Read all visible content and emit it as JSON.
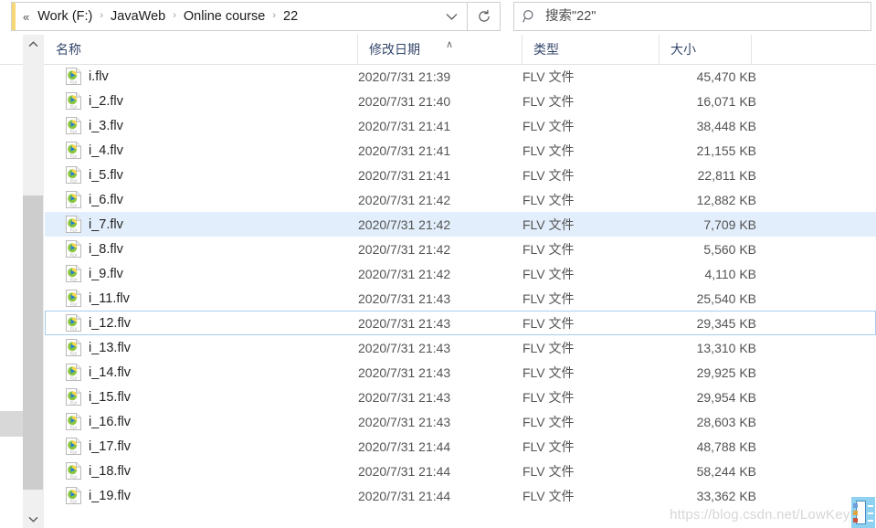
{
  "window": {
    "address": {
      "overflow_indicator": "«",
      "separator": "›",
      "breadcrumbs": [
        "Work (F:)",
        "JavaWeb",
        "Online course",
        "22"
      ],
      "dropdown_icon": "chevron-down-icon",
      "refresh_icon": "refresh-icon"
    },
    "search": {
      "icon": "search-icon",
      "placeholder": "搜索\"22\"",
      "value": ""
    }
  },
  "columns": [
    {
      "key": "name",
      "label": "名称",
      "sorted": false
    },
    {
      "key": "date",
      "label": "修改日期",
      "sorted": true,
      "sort_direction": "ascending",
      "sort_glyph": "∧"
    },
    {
      "key": "type",
      "label": "类型",
      "sorted": false
    },
    {
      "key": "size",
      "label": "大小",
      "sorted": false
    }
  ],
  "files": [
    {
      "name": "i.flv",
      "date": "2020/7/31 21:39",
      "type": "FLV 文件",
      "size": "45,470 KB",
      "icon": "flv-file-icon",
      "state": "normal"
    },
    {
      "name": "i_2.flv",
      "date": "2020/7/31 21:40",
      "type": "FLV 文件",
      "size": "16,071 KB",
      "icon": "flv-file-icon",
      "state": "normal"
    },
    {
      "name": "i_3.flv",
      "date": "2020/7/31 21:41",
      "type": "FLV 文件",
      "size": "38,448 KB",
      "icon": "flv-file-icon",
      "state": "normal"
    },
    {
      "name": "i_4.flv",
      "date": "2020/7/31 21:41",
      "type": "FLV 文件",
      "size": "21,155 KB",
      "icon": "flv-file-icon",
      "state": "normal"
    },
    {
      "name": "i_5.flv",
      "date": "2020/7/31 21:41",
      "type": "FLV 文件",
      "size": "22,811 KB",
      "icon": "flv-file-icon",
      "state": "normal"
    },
    {
      "name": "i_6.flv",
      "date": "2020/7/31 21:42",
      "type": "FLV 文件",
      "size": "12,882 KB",
      "icon": "flv-file-icon",
      "state": "normal"
    },
    {
      "name": "i_7.flv",
      "date": "2020/7/31 21:42",
      "type": "FLV 文件",
      "size": "7,709 KB",
      "icon": "flv-file-icon",
      "state": "selected"
    },
    {
      "name": "i_8.flv",
      "date": "2020/7/31 21:42",
      "type": "FLV 文件",
      "size": "5,560 KB",
      "icon": "flv-file-icon",
      "state": "normal"
    },
    {
      "name": "i_9.flv",
      "date": "2020/7/31 21:42",
      "type": "FLV 文件",
      "size": "4,110 KB",
      "icon": "flv-file-icon",
      "state": "normal"
    },
    {
      "name": "i_11.flv",
      "date": "2020/7/31 21:43",
      "type": "FLV 文件",
      "size": "25,540 KB",
      "icon": "flv-file-icon",
      "state": "normal"
    },
    {
      "name": "i_12.flv",
      "date": "2020/7/31 21:43",
      "type": "FLV 文件",
      "size": "29,345 KB",
      "icon": "flv-file-icon",
      "state": "focused"
    },
    {
      "name": "i_13.flv",
      "date": "2020/7/31 21:43",
      "type": "FLV 文件",
      "size": "13,310 KB",
      "icon": "flv-file-icon",
      "state": "normal"
    },
    {
      "name": "i_14.flv",
      "date": "2020/7/31 21:43",
      "type": "FLV 文件",
      "size": "29,925 KB",
      "icon": "flv-file-icon",
      "state": "normal"
    },
    {
      "name": "i_15.flv",
      "date": "2020/7/31 21:43",
      "type": "FLV 文件",
      "size": "29,954 KB",
      "icon": "flv-file-icon",
      "state": "normal"
    },
    {
      "name": "i_16.flv",
      "date": "2020/7/31 21:43",
      "type": "FLV 文件",
      "size": "28,603 KB",
      "icon": "flv-file-icon",
      "state": "normal"
    },
    {
      "name": "i_17.flv",
      "date": "2020/7/31 21:44",
      "type": "FLV 文件",
      "size": "48,788 KB",
      "icon": "flv-file-icon",
      "state": "normal"
    },
    {
      "name": "i_18.flv",
      "date": "2020/7/31 21:44",
      "type": "FLV 文件",
      "size": "58,244 KB",
      "icon": "flv-file-icon",
      "state": "normal"
    },
    {
      "name": "i_19.flv",
      "date": "2020/7/31 21:44",
      "type": "FLV 文件",
      "size": "33,362 KB",
      "icon": "flv-file-icon",
      "state": "clipped"
    }
  ],
  "scrollbar": {
    "up_arrow": "chevron-up-icon",
    "down_arrow": "chevron-down-icon"
  },
  "watermark": {
    "text": "https://blog.csdn.net/LowKeyL"
  },
  "colors": {
    "selection_fill": "#e2eefb",
    "focus_border": "#a8cdeb",
    "header_text": "#34476b",
    "body_text": "#545454",
    "scrollbar_thumb": "#cdcdcd",
    "address_accent": "#f8d775",
    "watermark": "#d6d6d6"
  }
}
